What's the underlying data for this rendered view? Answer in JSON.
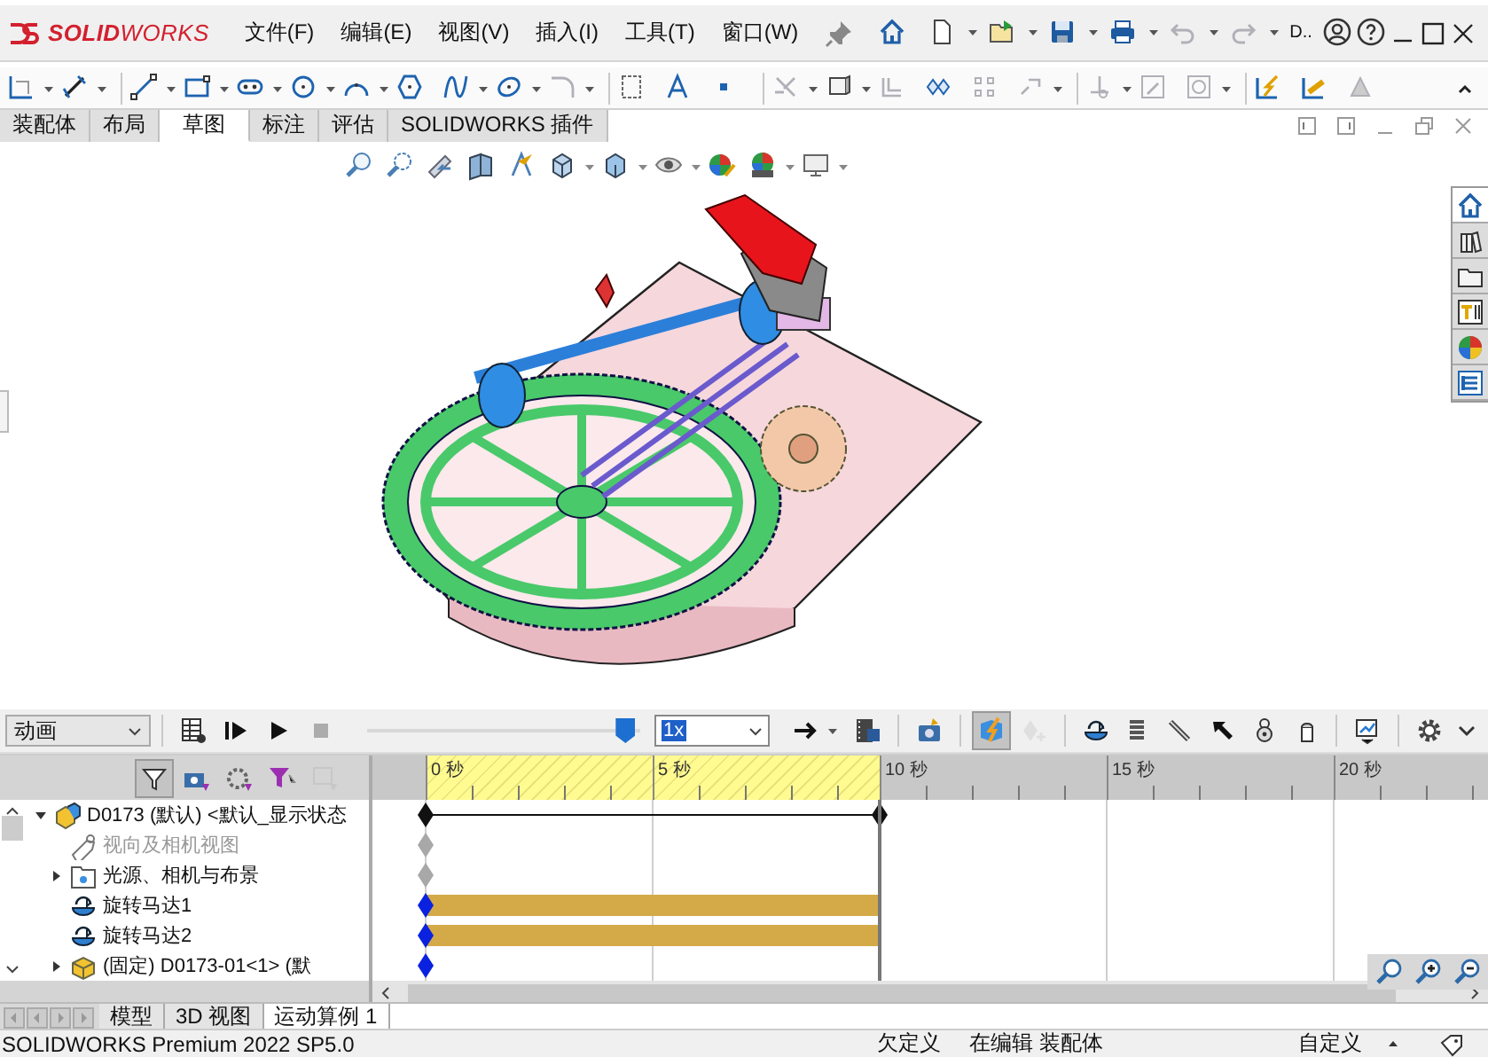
{
  "app": {
    "logo": "**SOLID**WORKS",
    "menus": [
      "文件(F)",
      "编辑(E)",
      "视图(V)",
      "插入(I)",
      "工具(T)",
      "窗口(W)"
    ],
    "search_label": "D.."
  },
  "command_tabs": [
    {
      "label": "装配体",
      "selected": false
    },
    {
      "label": "布局",
      "selected": false
    },
    {
      "label": "草图",
      "selected": true
    },
    {
      "label": "标注",
      "selected": false
    },
    {
      "label": "评估",
      "selected": false
    },
    {
      "label": "SOLIDWORKS 插件",
      "selected": false
    }
  ],
  "motion": {
    "study_type": "动画",
    "playback_tools": [
      {
        "kind": "calculate",
        "disabled": false
      },
      {
        "kind": "play-start",
        "disabled": false
      },
      {
        "kind": "play",
        "disabled": false
      },
      {
        "kind": "stop",
        "disabled": true
      }
    ],
    "slider": {
      "level": 0.97
    },
    "speed": "1x",
    "tools": [
      {
        "kind": "save-animation",
        "selected": false,
        "disabled": false
      },
      {
        "kind": "camera",
        "selected": false,
        "disabled": false
      },
      {
        "kind": "wizard",
        "selected": true,
        "disabled": false
      },
      {
        "kind": "keyframe",
        "selected": false,
        "disabled": true
      },
      {
        "kind": "motor",
        "selected": false,
        "disabled": false
      },
      {
        "kind": "spring",
        "selected": false,
        "disabled": false
      },
      {
        "kind": "contact",
        "selected": false,
        "disabled": false
      },
      {
        "kind": "pointer",
        "selected": false,
        "disabled": false
      },
      {
        "kind": "weight",
        "selected": false,
        "disabled": false
      },
      {
        "kind": "cup",
        "selected": false,
        "disabled": false
      },
      {
        "kind": "results",
        "selected": false,
        "disabled": false
      },
      {
        "kind": "settings",
        "selected": false,
        "disabled": false
      }
    ],
    "filters": [
      {
        "selected": true,
        "disabled": false
      },
      {
        "selected": false,
        "disabled": false
      },
      {
        "selected": false,
        "disabled": false
      },
      {
        "selected": false,
        "disabled": false
      },
      {
        "selected": false,
        "disabled": true
      }
    ],
    "ruler": [
      {
        "label": "0 秒",
        "in_range": true
      },
      {
        "label": "5 秒",
        "in_range": true
      },
      {
        "label": "10 秒",
        "in_range": false
      },
      {
        "label": "15 秒",
        "in_range": false
      },
      {
        "label": "20 秒",
        "in_range": false
      }
    ],
    "tree": [
      {
        "label": "D0173 (默认) <默认_显示状态",
        "kind": "assembly",
        "expanded": true,
        "disabled": false,
        "track": {
          "kind": "span"
        },
        "children": [
          {
            "label": "视向及相机视图",
            "kind": "views",
            "disabled": true,
            "track": {
              "kind": "inactive-key"
            }
          },
          {
            "label": "光源、相机与布景",
            "kind": "lights",
            "expanded": false,
            "disabled": false,
            "track": {
              "kind": "inactive-key"
            }
          },
          {
            "label": "旋转马达1",
            "kind": "motor",
            "disabled": false,
            "track": {
              "kind": "bar"
            }
          },
          {
            "label": "旋转马达2",
            "kind": "motor",
            "disabled": false,
            "track": {
              "kind": "bar"
            }
          },
          {
            "label": "(固定) D0173-01<1> (默",
            "kind": "part",
            "expanded": false,
            "disabled": false,
            "track": {
              "kind": "key"
            }
          }
        ]
      }
    ]
  },
  "document_tabs": [
    {
      "label": "模型",
      "selected": false
    },
    {
      "label": "3D 视图",
      "selected": false
    },
    {
      "label": "运动算例 1",
      "selected": true
    }
  ],
  "status_bar": {
    "product": "SOLIDWORKS Premium 2022 SP5.0",
    "state": "欠定义",
    "mode": "在编辑 装配体",
    "units": "自定义"
  }
}
